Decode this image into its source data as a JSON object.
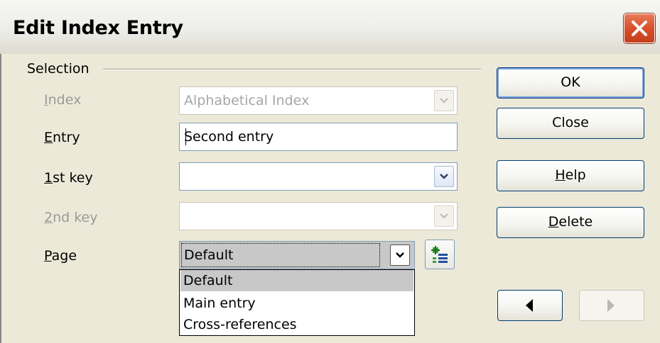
{
  "window": {
    "title": "Edit Index Entry",
    "close_icon": "close-x-icon"
  },
  "selection": {
    "group_label": "Selection",
    "index": {
      "label_mnemonic": "I",
      "label_rest": "ndex",
      "value": "Alphabetical Index",
      "enabled": false
    },
    "entry": {
      "label_mnemonic": "E",
      "label_rest": "ntry",
      "value": "Second entry"
    },
    "key1": {
      "label_mnemonic": "1",
      "label_rest": "st key",
      "value": ""
    },
    "key2": {
      "label_mnemonic": "2",
      "label_rest": "nd key",
      "value": "",
      "enabled": false
    },
    "page": {
      "label_mnemonic": "P",
      "label_rest": "age",
      "value": "Default",
      "options": [
        "Default",
        "Main entry",
        "Cross-references"
      ],
      "selected_index": 0
    }
  },
  "buttons": {
    "ok": "OK",
    "close": "Close",
    "help_mnemonic": "H",
    "help_rest": "elp",
    "delete_mnemonic": "D",
    "delete_rest": "elete"
  },
  "icons": {
    "dropdown": "chevron-down-icon",
    "add_list": "add-list-icon",
    "previous": "previous-arrow-icon",
    "next": "next-arrow-icon"
  },
  "colors": {
    "face": "#ece9d8",
    "close_red": "#d9502b",
    "border_blue": "#7f9db9",
    "selected_gray": "#c8c8c8"
  }
}
